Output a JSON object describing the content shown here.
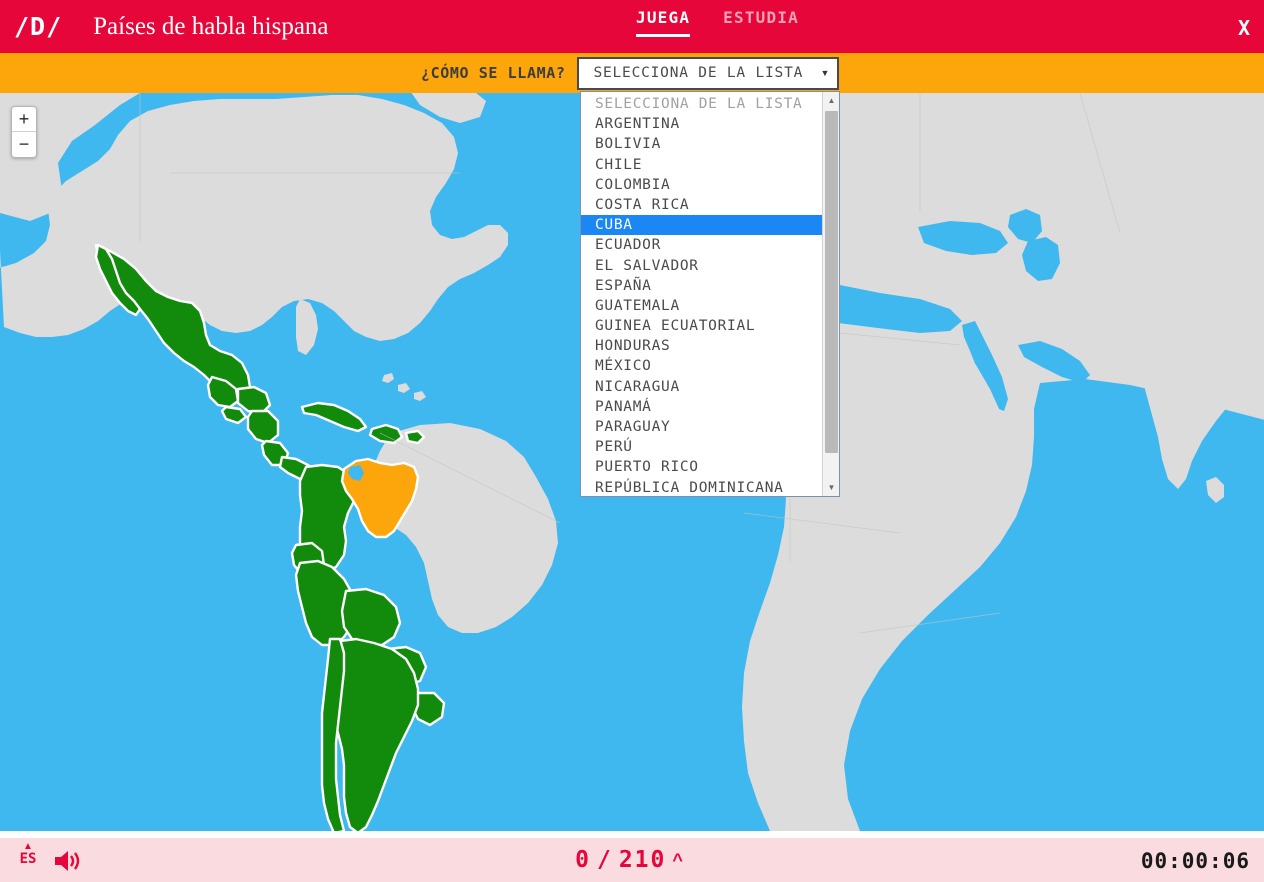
{
  "header": {
    "logo": "/D/",
    "title": "Países de habla hispana",
    "tabs": [
      {
        "label": "JUEGA",
        "active": true
      },
      {
        "label": "ESTUDIA",
        "active": false
      }
    ],
    "close_label": "X"
  },
  "question_bar": {
    "prompt": "¿CÓMO SE LLAMA?",
    "select_value": "SELECCIONA DE LA LISTA",
    "caret_icon": "chevron-down-icon"
  },
  "dropdown": {
    "open": true,
    "selected": "CUBA",
    "options": [
      "SELECCIONA DE LA LISTA",
      "ARGENTINA",
      "BOLIVIA",
      "CHILE",
      "COLOMBIA",
      "COSTA RICA",
      "CUBA",
      "ECUADOR",
      "EL SALVADOR",
      "ESPAÑA",
      "GUATEMALA",
      "GUINEA ECUATORIAL",
      "HONDURAS",
      "MÉXICO",
      "NICARAGUA",
      "PANAMÁ",
      "PARAGUAY",
      "PERÚ",
      "PUERTO RICO",
      "REPÚBLICA DOMINICANA"
    ],
    "scroll_up_icon": "triangle-up-icon",
    "scroll_down_icon": "triangle-down-icon"
  },
  "map": {
    "zoom_in_label": "+",
    "zoom_out_label": "−",
    "ocean_color": "#3fb8ef",
    "land_color": "#dcdcdc",
    "answered_color": "#128a0c",
    "target_color": "#fca60b",
    "target_country": "Venezuela"
  },
  "footer": {
    "language": "ES",
    "language_caret_icon": "caret-up-icon",
    "sound_icon": "speaker-on-icon",
    "score_current": "0",
    "score_separator": "/",
    "score_total": "210",
    "score_caret_icon": "chevron-up-icon",
    "timer": "00:00:06"
  }
}
